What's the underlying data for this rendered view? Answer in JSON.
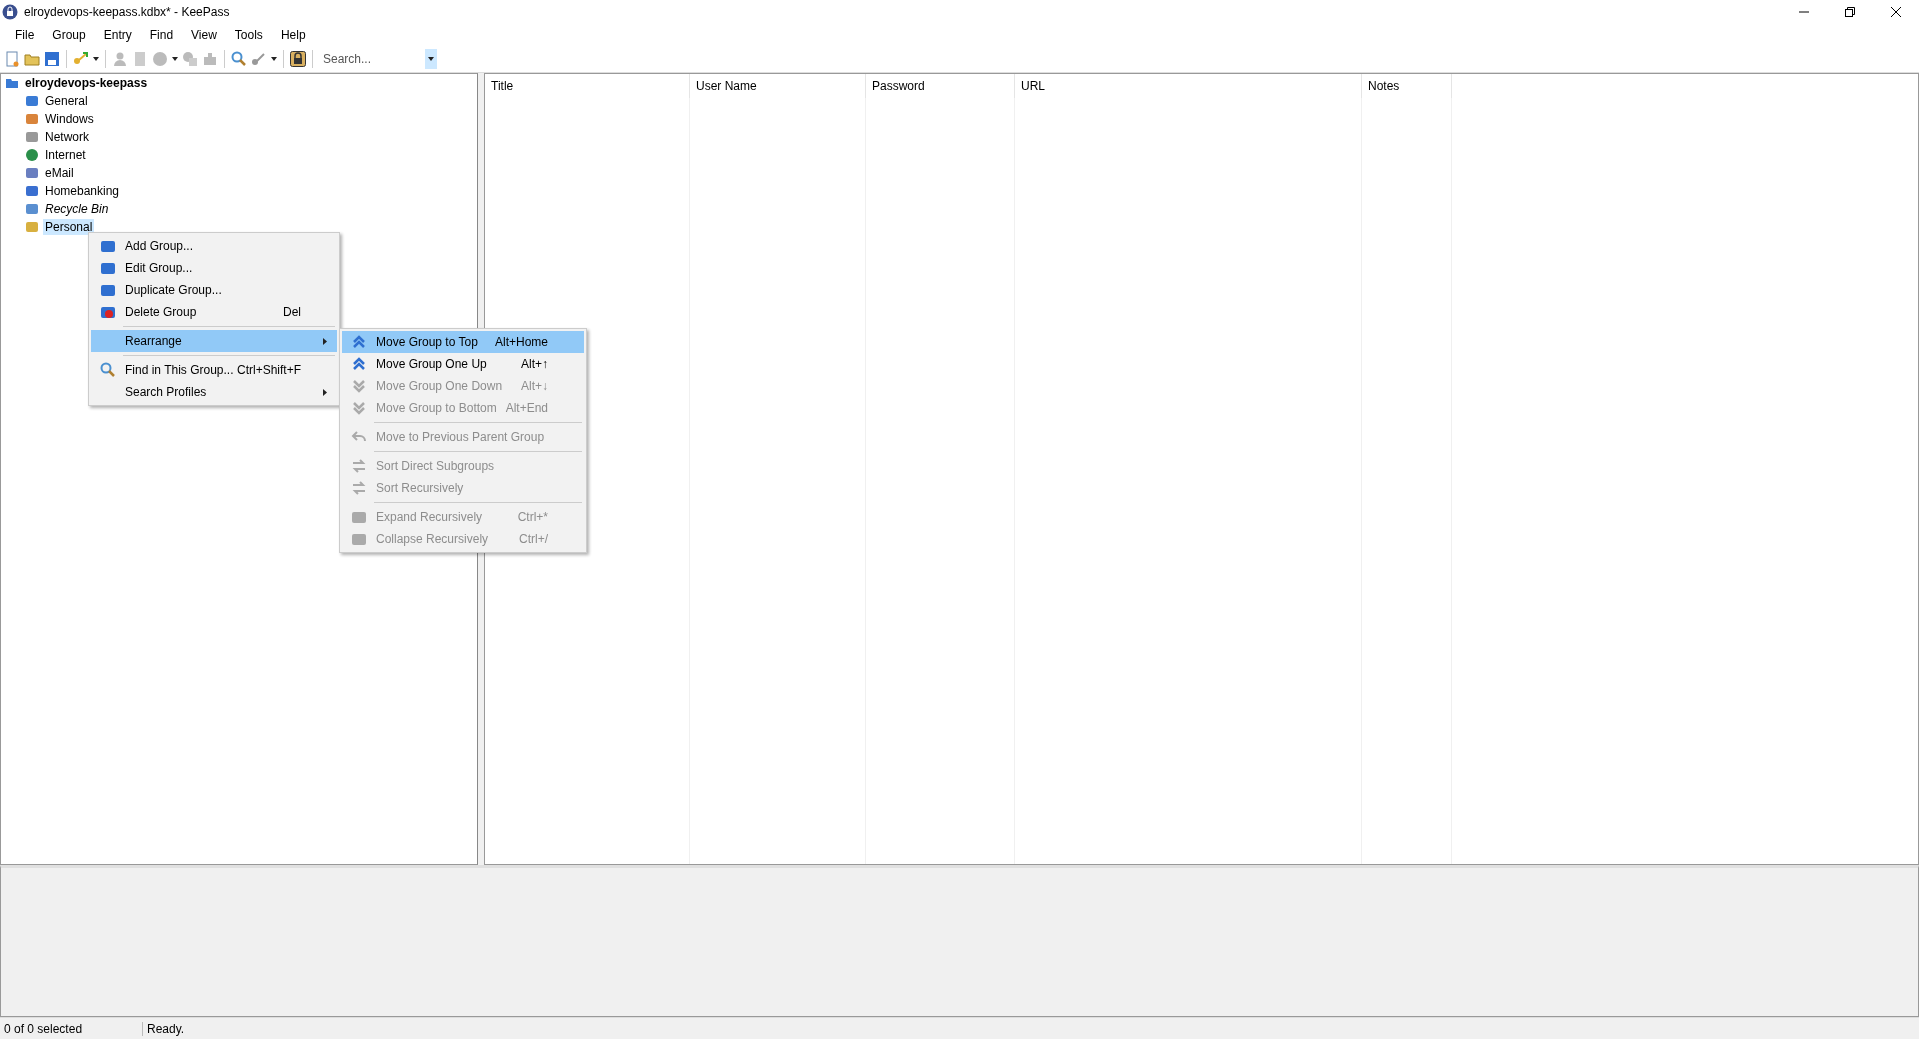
{
  "window": {
    "title": "elroydevops-keepass.kdbx* - KeePass"
  },
  "menu_bar": [
    "File",
    "Group",
    "Entry",
    "Find",
    "View",
    "Tools",
    "Help"
  ],
  "toolbar": {
    "search": {
      "placeholder": "Search..."
    }
  },
  "tree": {
    "label": "elroydevops-keepass",
    "selected": false,
    "children": [
      {
        "label": "General",
        "kind": "group",
        "selected": false
      },
      {
        "label": "Windows",
        "kind": "group",
        "selected": false
      },
      {
        "label": "Network",
        "kind": "group",
        "selected": false
      },
      {
        "label": "Internet",
        "kind": "group",
        "selected": false
      },
      {
        "label": "eMail",
        "kind": "group",
        "selected": false
      },
      {
        "label": "Homebanking",
        "kind": "group",
        "selected": false
      },
      {
        "label": "Recycle Bin",
        "kind": "recycle_bin",
        "selected": false
      },
      {
        "label": "Personal",
        "kind": "group",
        "selected": true
      }
    ]
  },
  "table": {
    "columns": [
      "Title",
      "User Name",
      "Password",
      "URL",
      "Notes"
    ]
  },
  "context_menu": {
    "sections": [
      [
        {
          "label": "Add Group...",
          "submenu": false,
          "selected": false,
          "disabled": false
        },
        {
          "label": "Edit Group...",
          "submenu": false,
          "selected": false,
          "disabled": false
        },
        {
          "label": "Duplicate Group...",
          "submenu": false,
          "selected": false,
          "disabled": false
        },
        {
          "label": "Delete Group",
          "shortcut": "Del",
          "submenu": false,
          "selected": false,
          "disabled": false
        }
      ],
      [
        {
          "label": "Rearrange",
          "submenu": true,
          "selected": true,
          "disabled": false
        }
      ],
      [
        {
          "label": "Find in This Group...",
          "shortcut": "Ctrl+Shift+F",
          "submenu": false,
          "selected": false,
          "disabled": false
        },
        {
          "label": "Search Profiles",
          "submenu": true,
          "selected": false,
          "disabled": false
        }
      ]
    ]
  },
  "submenu": {
    "sections": [
      [
        {
          "label": "Move Group to Top",
          "shortcut": "Alt+Home",
          "submenu": false,
          "selected": true,
          "disabled": false
        },
        {
          "label": "Move Group One Up",
          "shortcut": "Alt+↑",
          "submenu": false,
          "selected": false,
          "disabled": false
        },
        {
          "label": "Move Group One Down",
          "shortcut": "Alt+↓",
          "submenu": false,
          "selected": false,
          "disabled": true
        },
        {
          "label": "Move Group to Bottom",
          "shortcut": "Alt+End",
          "submenu": false,
          "selected": false,
          "disabled": true
        }
      ],
      [
        {
          "label": "Move to Previous Parent Group",
          "submenu": false,
          "selected": false,
          "disabled": true
        }
      ],
      [
        {
          "label": "Sort Direct Subgroups",
          "submenu": false,
          "selected": false,
          "disabled": true
        },
        {
          "label": "Sort Recursively",
          "submenu": false,
          "selected": false,
          "disabled": true
        }
      ],
      [
        {
          "label": "Expand Recursively",
          "shortcut": "Ctrl+*",
          "submenu": false,
          "selected": false,
          "disabled": true
        },
        {
          "label": "Collapse Recursively",
          "shortcut": "Ctrl+/",
          "submenu": false,
          "selected": false,
          "disabled": true
        }
      ]
    ]
  },
  "status_bar": {
    "selection": "0 of 0 selected",
    "message": "Ready."
  }
}
